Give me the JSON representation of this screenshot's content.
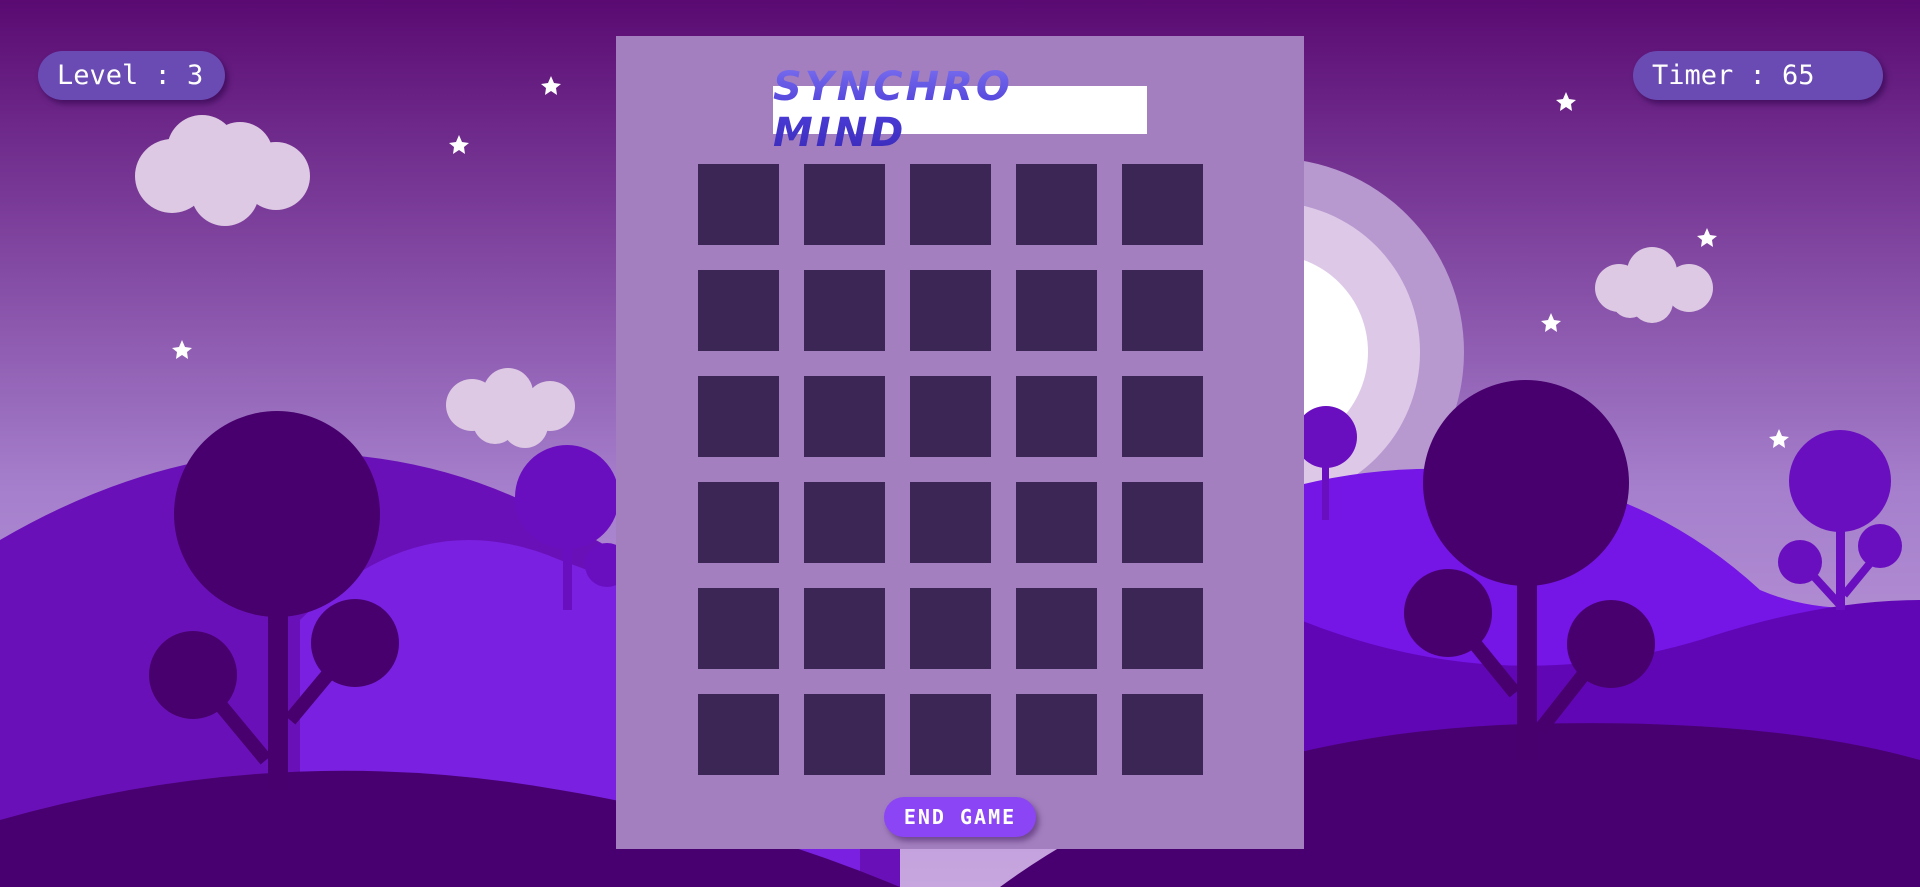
{
  "hud": {
    "level_label": "Level : 3",
    "timer_label": "Timer : 65"
  },
  "board": {
    "title": "SYNCHRO MIND",
    "rows": 6,
    "columns": 5,
    "card_state": "face-down",
    "end_button_label": "END GAME"
  },
  "colors": {
    "sky_top": "#5a0a72",
    "sky_bottom": "#b08ad0",
    "panel": "#a37fbf",
    "card_back": "#3c2655",
    "hud_pill": "#6a4bb3",
    "end_button": "#8b45f5"
  },
  "icons": [
    "cloud-icon",
    "star-icon",
    "moon-icon",
    "tree-icon"
  ]
}
